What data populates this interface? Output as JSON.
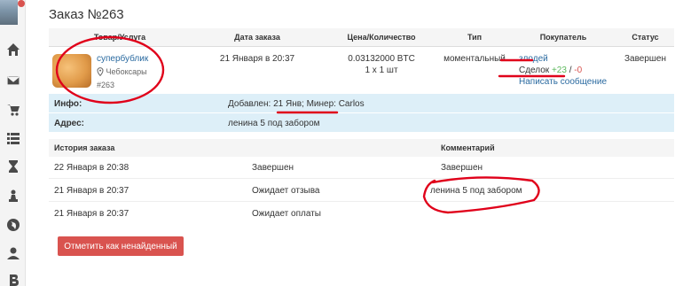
{
  "order": {
    "title": "Заказ №263",
    "columns": [
      "Товар/Услуга",
      "Дата заказа",
      "Цена/Количество",
      "Тип",
      "Покупатель",
      "Статус"
    ],
    "product_name": "супербублик",
    "product_city": "Чебоксары",
    "product_id": "#263",
    "date": "21 Января в 20:37",
    "price": "0.03132000 BTC",
    "quantity": "1 x 1 шт",
    "type": "моментальный",
    "buyer_name": "злодей",
    "deals_label": "Сделок",
    "deals_plus": "+23",
    "deals_sep": "/",
    "deals_minus": "-0",
    "message_link": "Написать сообщение",
    "status": "Завершен"
  },
  "info": {
    "info_label": "Инфо:",
    "added_text": "Добавлен: 21 Янв;",
    "miner_text": "Минер: Carlos",
    "address_label": "Адрес:",
    "address_value": "ленина 5 под забором"
  },
  "history": {
    "header_history": "История заказа",
    "header_comment": "Комментарий",
    "rows": [
      {
        "date": "22 Января в 20:38",
        "status": "Завершен",
        "comment": "Завершен"
      },
      {
        "date": "21 Января в 20:37",
        "status": "Ожидает отзыва",
        "comment": "ленина 5 под забором"
      },
      {
        "date": "21 Января в 20:37",
        "status": "Ожидает оплаты",
        "comment": ""
      }
    ]
  },
  "actions": {
    "not_found_button": "Отметить как ненайденный"
  },
  "sidebar": {
    "icons": [
      "home-icon",
      "mail-icon",
      "cart-icon",
      "list-icon",
      "hourglass-icon",
      "chess-pawn-icon",
      "globe-icon",
      "user-icon",
      "bitcoin-icon"
    ]
  },
  "colors": {
    "accent": "#d9534f",
    "link": "#2a6aa0",
    "positive": "#5cb85c",
    "negative": "#d9534f",
    "info_bg": "#ddeff8",
    "annotation": "#e0001a"
  }
}
